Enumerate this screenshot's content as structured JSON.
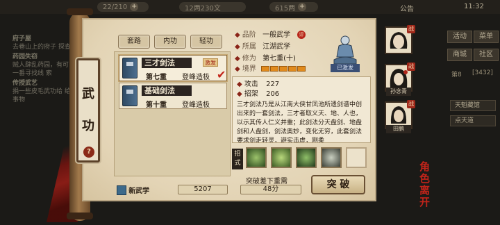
{
  "topbar": {
    "stamina": "22/210",
    "copper": "12两230文",
    "silver": "615两",
    "notice": "公告",
    "time": "11:32"
  },
  "bg_quests": [
    {
      "title": "府子屋",
      "text": "去巷山上的府子 探查地势"
    },
    {
      "title": "药园失窃",
      "text": "贼人肆乱药园，有可 面内调查一番寻找线 索"
    },
    {
      "title": "传授武艺",
      "text": "捐一些皮毛武功给 给需需精的事物"
    }
  ],
  "right_menu": {
    "buttons": [
      "活动",
      "菜单",
      "商城",
      "社区"
    ],
    "stat": "第8",
    "stat2": "[3432]",
    "pills": [
      "天魁藏馆",
      "点天道"
    ]
  },
  "panel_title": "武功",
  "help_label": "?",
  "tabs": [
    "套路",
    "内功",
    "轻功"
  ],
  "skills": [
    {
      "name": "三才剑法",
      "level": "第七重",
      "stage": "登峰造极",
      "badge": "激发",
      "selected": true
    },
    {
      "name": "基础剑法",
      "level": "第十重",
      "stage": "登峰造极",
      "badge": "",
      "selected": false
    }
  ],
  "info": {
    "grade_label": "品阶",
    "grade": "一般武学",
    "grade_seal": "评",
    "belong_label": "所属",
    "belong": "江湖武学",
    "cultivation_label": "修为",
    "cultivation": "第七重(十)",
    "realm_label": "境界",
    "realm_level": 5,
    "avatar_label": "已激发",
    "attack_label": "攻击",
    "attack": "227",
    "parry_label": "招架",
    "parry": "206",
    "description": "三才剑法乃是从江南大侠甘凤池所遗剑谱中创出来的一套剑法，三才者取义天、地、人也，以示其传人仁义并重；此剑法分天盘剑、地盘剑和人盘剑，剑法奥妙，变化无穷，此套剑法要求剑走轻灵，避实击虚，刚柔"
  },
  "moves_label": "招式",
  "bottom": {
    "new_skill_label": "新武学",
    "points": "5207",
    "breakthrough_label": "突破差下重需",
    "breakthrough_value": "48分",
    "break_button": "突  破"
  },
  "characters": [
    {
      "name": "",
      "fight": "战"
    },
    {
      "name": "孙念青",
      "fight": "战"
    },
    {
      "name": "田鹏",
      "fight": "战"
    }
  ],
  "char_footer": "角色 离开"
}
